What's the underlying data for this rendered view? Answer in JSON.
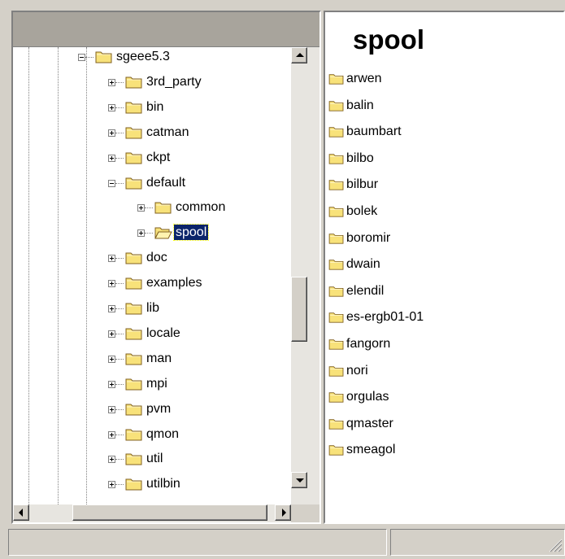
{
  "tree": {
    "root": {
      "label": "sgeee5.3",
      "expanded": true
    },
    "items": [
      {
        "label": "3rd_party",
        "expanded": false
      },
      {
        "label": "bin",
        "expanded": false
      },
      {
        "label": "catman",
        "expanded": false
      },
      {
        "label": "ckpt",
        "expanded": false
      },
      {
        "label": "default",
        "expanded": true,
        "children": [
          {
            "label": "common",
            "expanded": false
          },
          {
            "label": "spool",
            "expanded": false,
            "selected": true
          }
        ]
      },
      {
        "label": "doc",
        "expanded": false
      },
      {
        "label": "examples",
        "expanded": false
      },
      {
        "label": "lib",
        "expanded": false
      },
      {
        "label": "locale",
        "expanded": false
      },
      {
        "label": "man",
        "expanded": false
      },
      {
        "label": "mpi",
        "expanded": false
      },
      {
        "label": "pvm",
        "expanded": false
      },
      {
        "label": "qmon",
        "expanded": false
      },
      {
        "label": "util",
        "expanded": false
      },
      {
        "label": "utilbin",
        "expanded": false
      }
    ]
  },
  "content": {
    "title": "spool",
    "items": [
      "arwen",
      "balin",
      "baumbart",
      "bilbo",
      "bilbur",
      "bolek",
      "boromir",
      "dwain",
      "elendil",
      "es-ergb01-01",
      "fangorn",
      "nori",
      "orgulas",
      "qmaster",
      "smeagol"
    ]
  },
  "scroll": {
    "vertical_position": 0.62,
    "horizontal_position": 0.85
  },
  "icons": {
    "folder": "folder-icon",
    "open_folder": "open-folder-icon",
    "expand": "plus-box-icon",
    "collapse": "minus-box-icon",
    "scroll_up": "arrow-up-icon",
    "scroll_down": "arrow-down-icon",
    "scroll_left": "arrow-left-icon",
    "scroll_right": "arrow-right-icon",
    "resize_grip": "resize-grip-icon"
  },
  "colors": {
    "selection_bg": "#0a246a",
    "selection_fg": "#ffffff",
    "folder_fill": "#f8e27a",
    "folder_outline": "#806020",
    "face": "#d4d0c8"
  }
}
